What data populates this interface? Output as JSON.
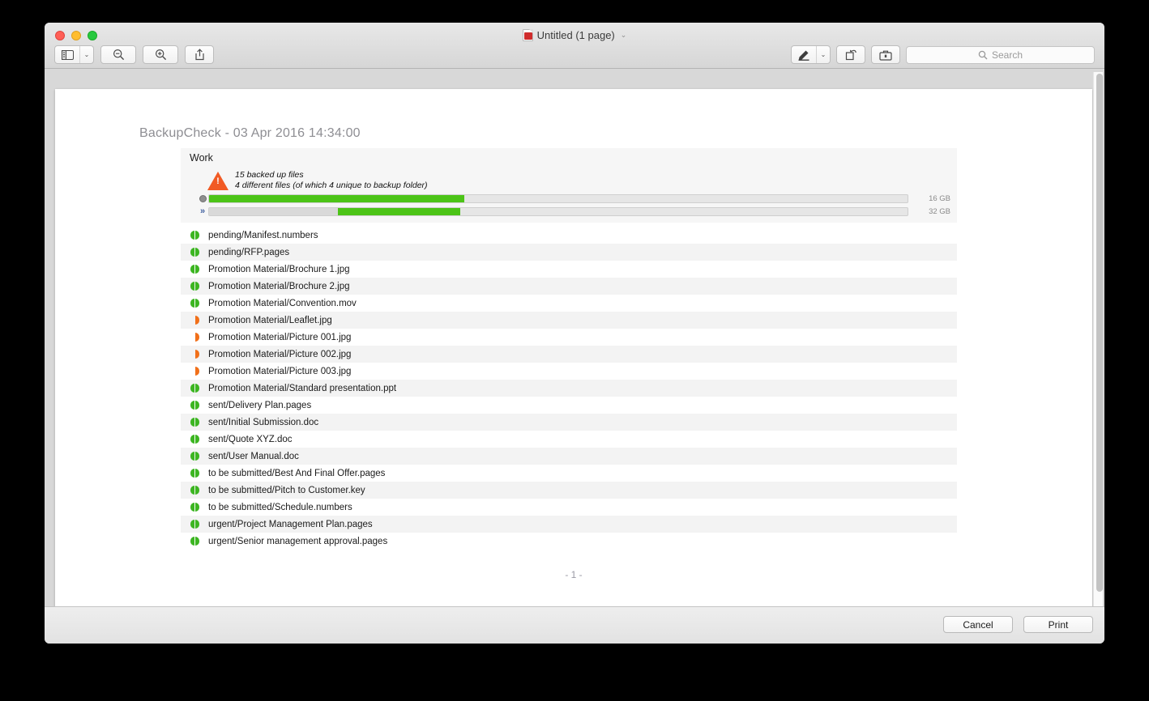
{
  "window": {
    "title": "Untitled (1 page)",
    "title_icon": "pdf-document-icon",
    "title_chevron": "⌄"
  },
  "toolbar": {
    "sidebar_button": "sidebar-view-icon",
    "sidebar_chevron": "⌄",
    "zoom_out": "zoom-out-icon",
    "zoom_in": "zoom-in-icon",
    "share": "share-icon",
    "markup": "markup-pen-icon",
    "markup_chevron": "⌄",
    "rotate": "rotate-icon",
    "toolbox": "toolbox-icon",
    "search_placeholder": "Search",
    "search_value": ""
  },
  "report": {
    "heading": "BackupCheck - 03 Apr 2016  14:34:00",
    "page_marker": "- 1 -"
  },
  "panel": {
    "name": "Work",
    "warning_icon": "warning-triangle-icon",
    "summary_line_1": "15 backed up files",
    "summary_line_2": "4 different files (of which 4 unique to backup folder)",
    "bars": [
      {
        "icon": "disc-icon",
        "capacity_label": "16 GB",
        "segments": [
          {
            "color": "#4cc417",
            "start_pct": 0,
            "width_pct": 36.5
          }
        ]
      },
      {
        "icon": "double-chevron-icon",
        "capacity_label": "32 GB",
        "segments": [
          {
            "color": "#d9d9d9",
            "start_pct": 0,
            "width_pct": 18.5
          },
          {
            "color": "#4cc417",
            "start_pct": 18.5,
            "width_pct": 17.5
          }
        ]
      }
    ]
  },
  "files": [
    {
      "status": "green",
      "name": "pending/Manifest.numbers"
    },
    {
      "status": "green",
      "name": "pending/RFP.pages"
    },
    {
      "status": "green",
      "name": "Promotion Material/Brochure 1.jpg"
    },
    {
      "status": "green",
      "name": "Promotion Material/Brochure 2.jpg"
    },
    {
      "status": "green",
      "name": "Promotion Material/Convention.mov"
    },
    {
      "status": "orange",
      "name": "Promotion Material/Leaflet.jpg"
    },
    {
      "status": "orange",
      "name": "Promotion Material/Picture 001.jpg"
    },
    {
      "status": "orange",
      "name": "Promotion Material/Picture 002.jpg"
    },
    {
      "status": "orange",
      "name": "Promotion Material/Picture 003.jpg"
    },
    {
      "status": "green",
      "name": "Promotion Material/Standard presentation.ppt"
    },
    {
      "status": "green",
      "name": "sent/Delivery Plan.pages"
    },
    {
      "status": "green",
      "name": "sent/Initial Submission.doc"
    },
    {
      "status": "green",
      "name": "sent/Quote XYZ.doc"
    },
    {
      "status": "green",
      "name": "sent/User Manual.doc"
    },
    {
      "status": "green",
      "name": "to be submitted/Best And Final Offer.pages"
    },
    {
      "status": "green",
      "name": "to be submitted/Pitch to Customer.key"
    },
    {
      "status": "green",
      "name": "to be submitted/Schedule.numbers"
    },
    {
      "status": "green",
      "name": "urgent/Project Management Plan.pages"
    },
    {
      "status": "green",
      "name": "urgent/Senior management approval.pages"
    }
  ],
  "footer": {
    "cancel_label": "Cancel",
    "print_label": "Print"
  },
  "colors": {
    "status_ok": "#3cb521",
    "status_warn": "#f1701a",
    "bar_fill": "#4cc417",
    "warning": "#f15a24"
  }
}
